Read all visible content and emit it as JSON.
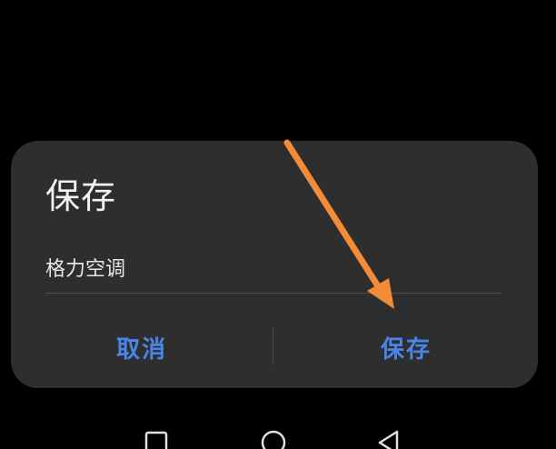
{
  "dialog": {
    "title": "保存",
    "input_value": "格力空调",
    "cancel_label": "取消",
    "save_label": "保存"
  },
  "colors": {
    "background": "#000000",
    "dialog_bg": "#2e2e2e",
    "accent": "#4a86e8",
    "annotation_arrow": "#f28c38"
  },
  "icons": {
    "nav_recent": "square-icon",
    "nav_home": "circle-icon",
    "nav_back": "triangle-back-icon"
  }
}
